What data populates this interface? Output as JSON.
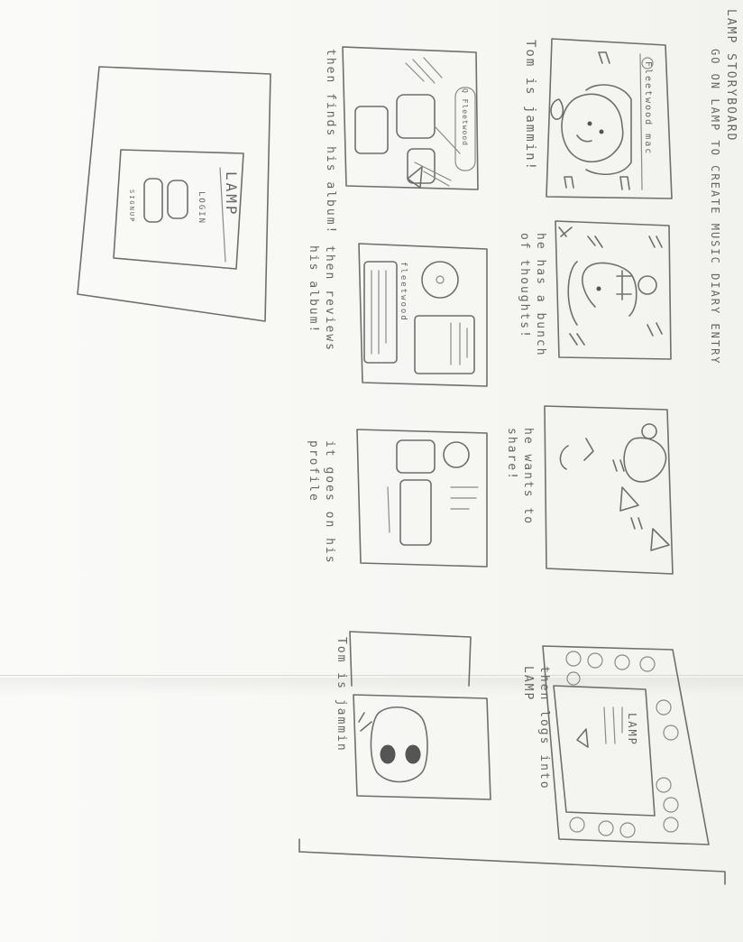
{
  "title": "LAMP STORYBOARD",
  "subtitle": "GO ON LAMP TO CREATE MUSIC DIARY ENTRY",
  "frames": {
    "f1": {
      "label": "Fleetwood mac",
      "caption": "Tom is jammin!"
    },
    "f2": {
      "search_label": "Q Fleetwood",
      "caption": "then finds his album!"
    },
    "f3": {
      "caption": "he has a bunch of thoughts!"
    },
    "f4": {
      "album_label": "fleetwood",
      "caption": "then reviews his album!"
    },
    "f5": {
      "caption": "he wants to share!"
    },
    "f6": {
      "caption": "it goes on his profile"
    },
    "f7": {
      "app_name": "LAMP",
      "login_label": "LOGIN",
      "signup_label": "SIGNUP"
    },
    "f8": {
      "caption": "then logs into LAMP",
      "app_name": "LAMP"
    },
    "f9": {
      "caption": "Tom is jammin"
    }
  }
}
